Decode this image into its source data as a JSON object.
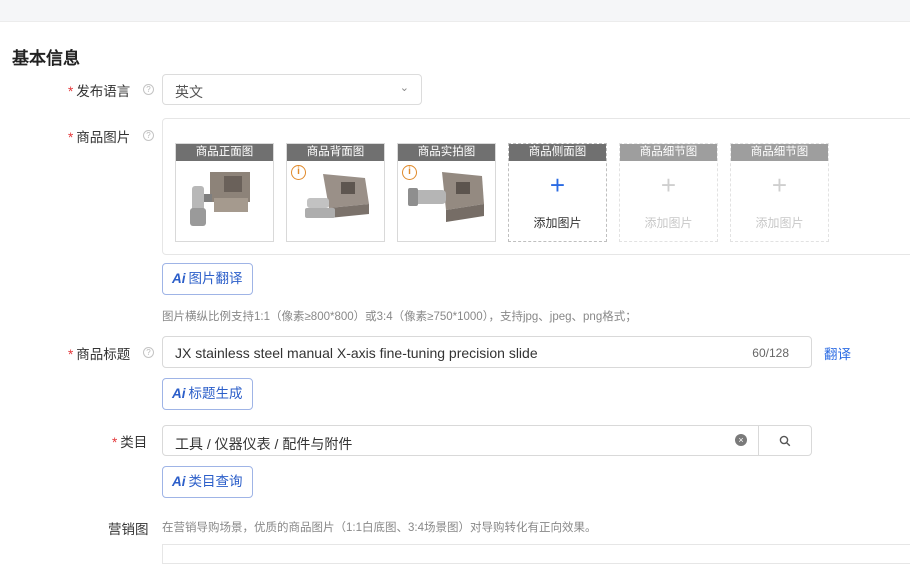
{
  "section": {
    "title": "基本信息"
  },
  "language": {
    "label": "发布语言",
    "value": "英文"
  },
  "images": {
    "label": "商品图片",
    "cards": [
      {
        "caption": "商品正面图",
        "state": "filled",
        "warning": false
      },
      {
        "caption": "商品背面图",
        "state": "filled",
        "warning": true
      },
      {
        "caption": "商品实拍图",
        "state": "filled",
        "warning": true
      },
      {
        "caption": "商品侧面图",
        "state": "empty",
        "add_label": "添加图片"
      },
      {
        "caption": "商品细节图",
        "state": "disabled",
        "add_label": "添加图片"
      },
      {
        "caption": "商品细节图",
        "state": "disabled",
        "add_label": "添加图片"
      }
    ],
    "ai_button": "图片翻译",
    "ai_badge": "Ai",
    "hint": "图片横纵比例支持1:1（像素≥800*800）或3:4（像素≥750*1000），支持jpg、jpeg、png格式；"
  },
  "product_title": {
    "label": "商品标题",
    "value": "JX stainless steel manual X-axis fine-tuning precision slide",
    "counter": "60/128",
    "translate_link": "翻译",
    "ai_button": "标题生成",
    "ai_badge": "Ai"
  },
  "category": {
    "label": "类目",
    "value": "工具 / 仪器仪表 / 配件与附件",
    "ai_button": "类目查询",
    "ai_badge": "Ai"
  },
  "marketing": {
    "label": "营销图",
    "hint": "在营销导购场景，优质的商品图片（1:1白底图、3:4场景图）对导购转化有正向效果。"
  },
  "colors": {
    "accent": "#2b6be3",
    "required": "#e4393c",
    "warning": "#e08a2b"
  }
}
